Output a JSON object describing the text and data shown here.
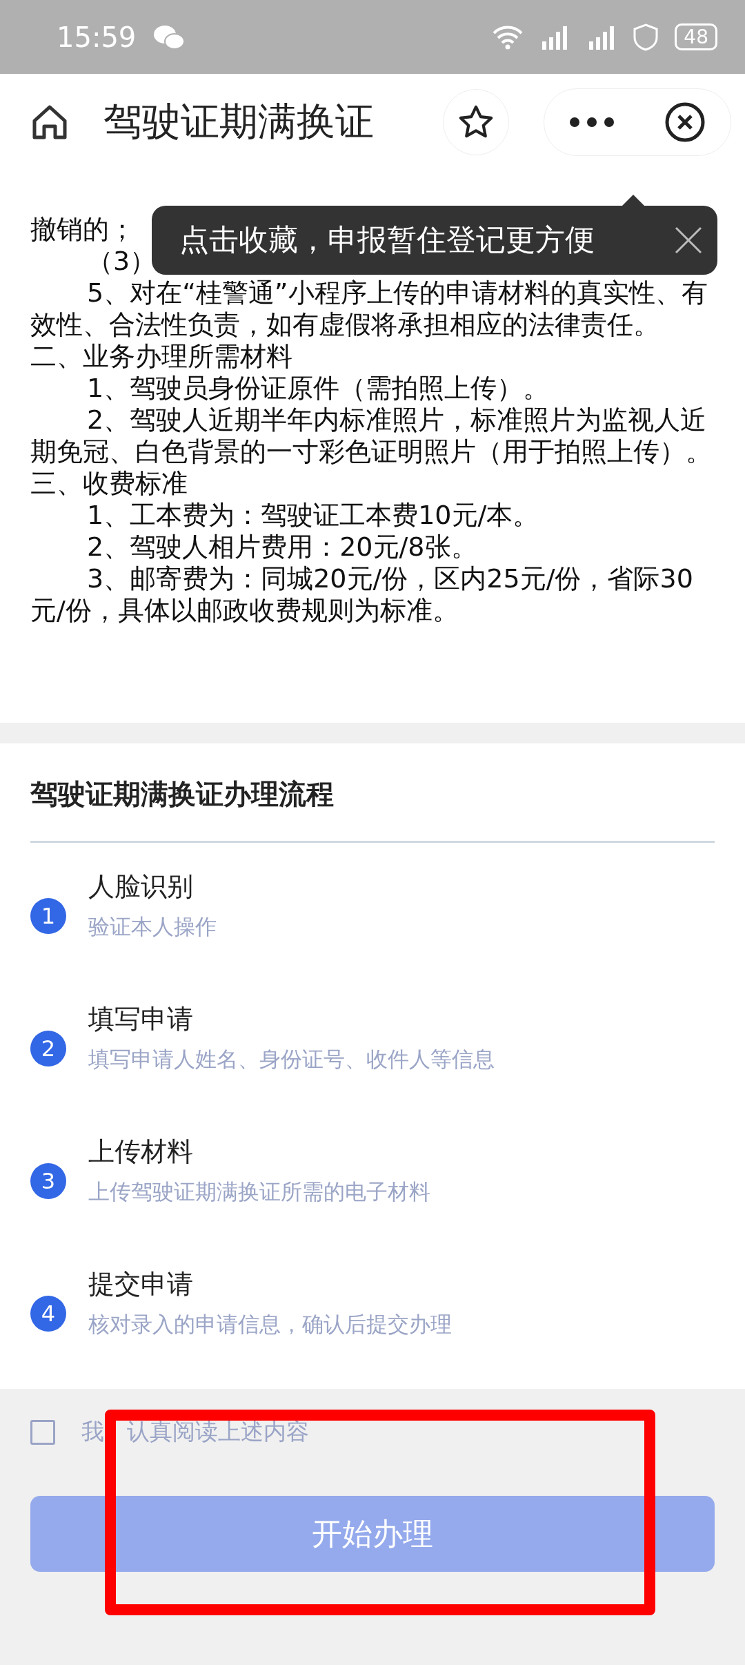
{
  "status_bar": {
    "time": "15:59",
    "battery": "48"
  },
  "header": {
    "title": "驾驶证期满换证"
  },
  "tooltip": {
    "text": "点击收藏，申报暂住登记更方便"
  },
  "notice": [
    {
      "kind": "wrap",
      "text": "撤销的；"
    },
    {
      "kind": "indent",
      "text": "（3）"
    },
    {
      "kind": "indent",
      "text": "5、对在“桂警通”小程序上传的申请材料的真实性、有效性、合法性负责，如有虚假将承担相应的法律责任。"
    },
    {
      "kind": "heading",
      "text": "二、业务办理所需材料"
    },
    {
      "kind": "indent",
      "text": "1、驾驶员身份证原件（需拍照上传）。"
    },
    {
      "kind": "indent",
      "text": "2、驾驶人近期半年内标准照片，标准照片为监视人近期免冠、白色背景的一寸彩色证明照片（用于拍照上传）。"
    },
    {
      "kind": "heading",
      "text": "三、收费标准"
    },
    {
      "kind": "indent",
      "text": "1、工本费为：驾驶证工本费10元/本。"
    },
    {
      "kind": "indent",
      "text": "2、驾驶人相片费用：20元/8张。"
    },
    {
      "kind": "indent",
      "text": "3、邮寄费为：同城20元/份，区内25元/份，省际30元/份，具体以邮政收费规则为标准。"
    }
  ],
  "process": {
    "title": "驾驶证期满换证办理流程",
    "steps": [
      {
        "number": "1",
        "title": "人脸识别",
        "description": "验证本人操作"
      },
      {
        "number": "2",
        "title": "填写申请",
        "description": "填写申请人姓名、身份证号、收件人等信息"
      },
      {
        "number": "3",
        "title": "上传材料",
        "description": "上传驾驶证期满换证所需的电子材料"
      },
      {
        "number": "4",
        "title": "提交申请",
        "description": "核对录入的申请信息，确认后提交办理"
      }
    ]
  },
  "agreement": {
    "label_start": "我",
    "label_end": "认真阅读上述内容",
    "checked": false
  },
  "start_button": {
    "label": "开始办理",
    "disabled": true
  }
}
